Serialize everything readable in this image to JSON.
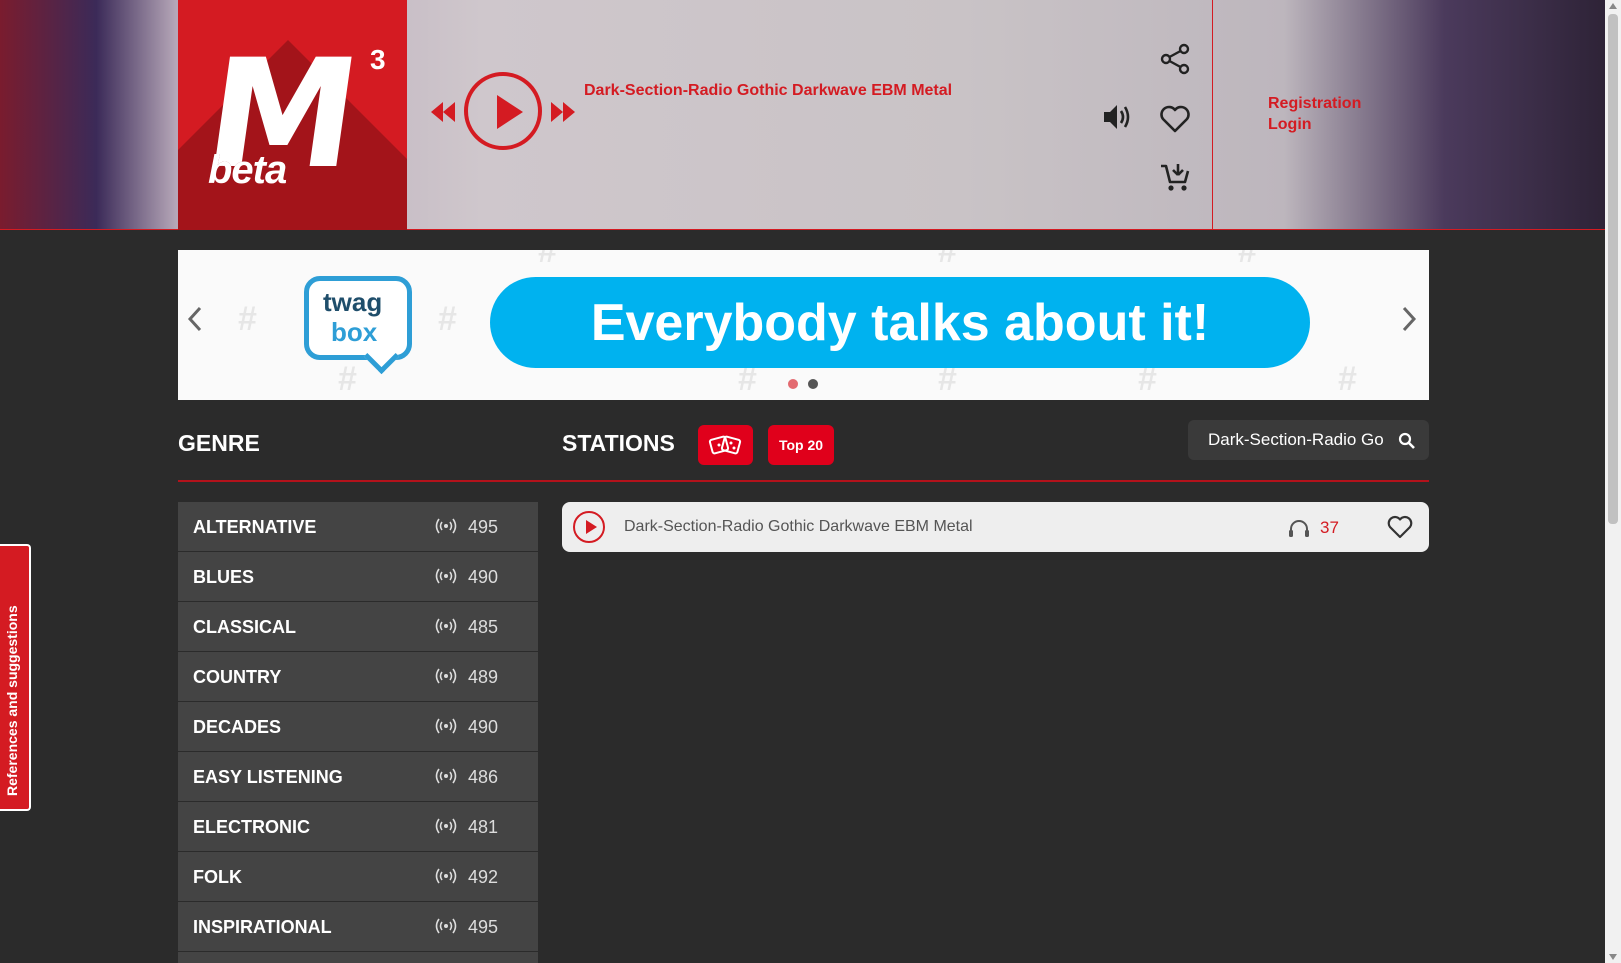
{
  "header": {
    "logo": {
      "mark": "M",
      "superscript": "3",
      "badge": "beta"
    },
    "now_playing": "Dark-Section-Radio Gothic Darkwave EBM Metal",
    "auth": {
      "registration": "Registration",
      "login": "Login"
    },
    "icons": [
      "share-icon",
      "volume-icon",
      "heart-icon",
      "cart-icon"
    ]
  },
  "banner": {
    "brand_line1": "twag",
    "brand_line2": "box",
    "headline": "Everybody talks about it!",
    "slides": 2,
    "active_slide": 1
  },
  "sections": {
    "genre_title": "GENRE",
    "stations_title": "STATIONS",
    "top20_label": "Top 20"
  },
  "search": {
    "value": "Dark-Section-Radio Go"
  },
  "genres": [
    {
      "name": "ALTERNATIVE",
      "count": "495"
    },
    {
      "name": "BLUES",
      "count": "490"
    },
    {
      "name": "CLASSICAL",
      "count": "485"
    },
    {
      "name": "COUNTRY",
      "count": "489"
    },
    {
      "name": "DECADES",
      "count": "490"
    },
    {
      "name": "EASY LISTENING",
      "count": "486"
    },
    {
      "name": "ELECTRONIC",
      "count": "481"
    },
    {
      "name": "FOLK",
      "count": "492"
    },
    {
      "name": "INSPIRATIONAL",
      "count": "495"
    }
  ],
  "stations": [
    {
      "name": "Dark-Section-Radio Gothic Darkwave EBM Metal",
      "listeners": "37"
    }
  ],
  "side_tab": {
    "label": "References and suggestions"
  },
  "colors": {
    "brand_red": "#d41b22",
    "banner_blue": "#00b2ef",
    "genre_bg": "#444444",
    "page_bg": "#2b2b2b"
  }
}
